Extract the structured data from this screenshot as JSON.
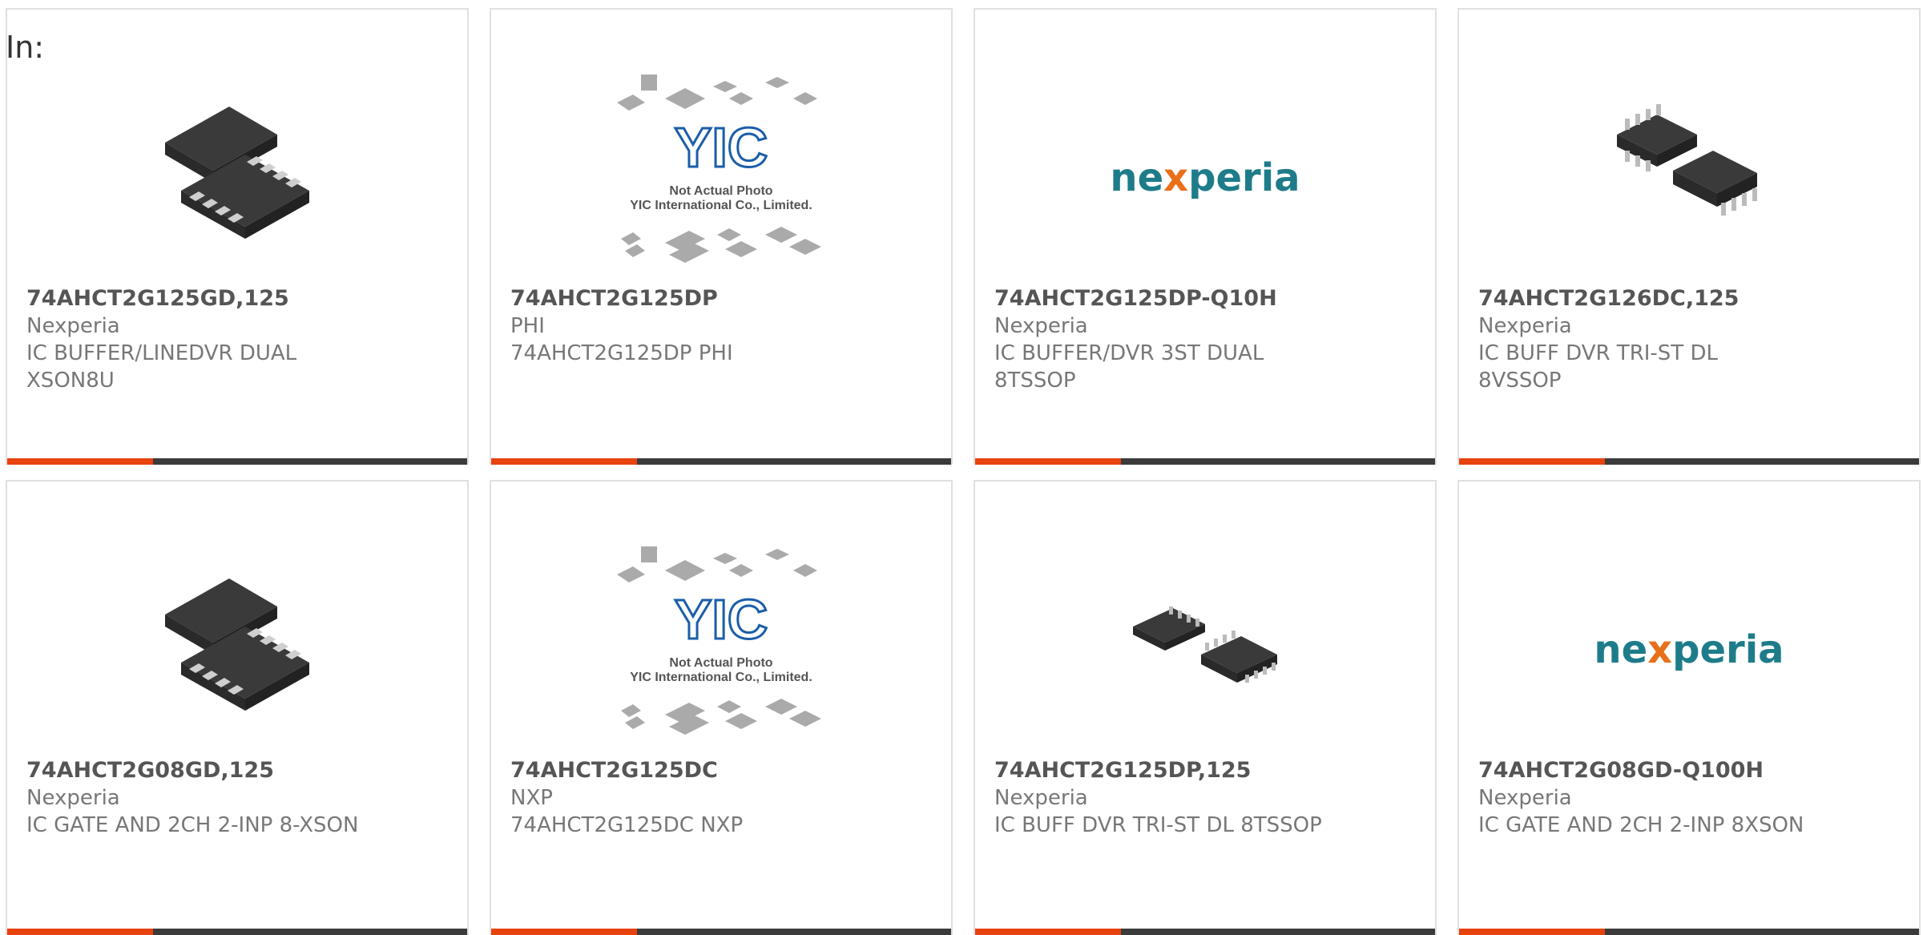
{
  "page": {
    "label": "In:"
  },
  "colors": {
    "accent": "#e8420f",
    "bar": "#3b3b3b",
    "nexperia_teal": "#1e7c8a",
    "nexperia_x": "#e8701a"
  },
  "products": [
    {
      "part": "74AHCT2G125GD,125",
      "manufacturer": "Nexperia",
      "description": "IC BUFFER/LINEDVR DUAL XSON8U",
      "image": "xson-chip-icon"
    },
    {
      "part": "74AHCT2G125DP",
      "manufacturer": "PHI",
      "description": "74AHCT2G125DP PHI",
      "image": "yic-not-actual-photo"
    },
    {
      "part": "74AHCT2G125DP-Q10H",
      "manufacturer": "Nexperia",
      "description": "IC BUFFER/DVR 3ST DUAL 8TSSOP",
      "image": "nexperia-logo"
    },
    {
      "part": "74AHCT2G126DC,125",
      "manufacturer": "Nexperia",
      "description": "IC BUFF DVR TRI-ST DL 8VSSOP",
      "image": "vssop-chip-icon"
    },
    {
      "part": "74AHCT2G08GD,125",
      "manufacturer": "Nexperia",
      "description": "IC GATE AND 2CH 2-INP 8-XSON",
      "image": "xson-chip-icon"
    },
    {
      "part": "74AHCT2G125DC",
      "manufacturer": "NXP",
      "description": "74AHCT2G125DC NXP",
      "image": "yic-not-actual-photo"
    },
    {
      "part": "74AHCT2G125DP,125",
      "manufacturer": "Nexperia",
      "description": "IC BUFF DVR TRI-ST DL 8TSSOP",
      "image": "tssop-chip-icon"
    },
    {
      "part": "74AHCT2G08GD-Q100H",
      "manufacturer": "Nexperia",
      "description": "IC GATE AND 2CH 2-INP 8XSON",
      "image": "nexperia-logo"
    }
  ],
  "yic": {
    "logo_text": "YIC",
    "line1": "Not Actual Photo",
    "line2": "YIC International Co., Limited."
  },
  "nexperia": {
    "part_a": "ne",
    "part_x": "x",
    "part_b": "peria"
  }
}
